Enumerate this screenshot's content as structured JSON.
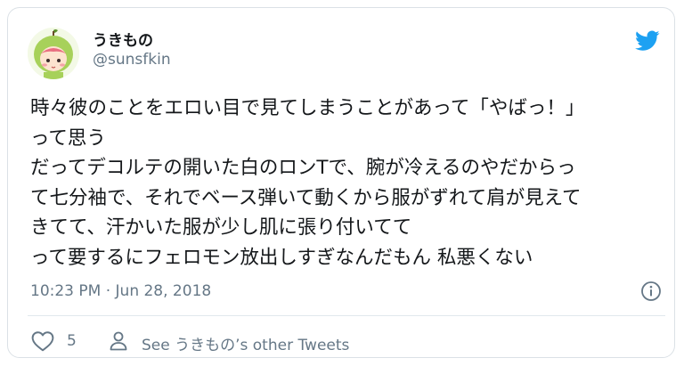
{
  "author": {
    "display_name": "うきもの",
    "handle": "@sunsfkin",
    "avatar_icon": "avatar-girl-pear-hood-icon"
  },
  "platform_icon": "twitter-bird-icon",
  "tweet": {
    "lines": [
      "時々彼のことをエロい目で見てしまうことがあって「やばっ！」",
      "って思う",
      "だってデコルテの開いた白のロンTで、腕が冷えるのやだからっ",
      "て七分袖で、それでベース弾いて動くから服がずれて肩が見えて",
      "きてて、汗かいた服が少し肌に張り付いてて",
      "って要するにフェロモン放出しすぎなんだもん 私悪くない"
    ],
    "timestamp": "10:23 PM · Jun 28, 2018"
  },
  "actions": {
    "like_icon": "heart-icon",
    "like_count": "5",
    "profile_icon": "person-icon",
    "see_other_label": "See うきもの’s other Tweets",
    "info_icon": "info-icon"
  },
  "colors": {
    "twitter_blue": "#1da1f2",
    "secondary_text": "#657786",
    "primary_text": "#14171a"
  }
}
